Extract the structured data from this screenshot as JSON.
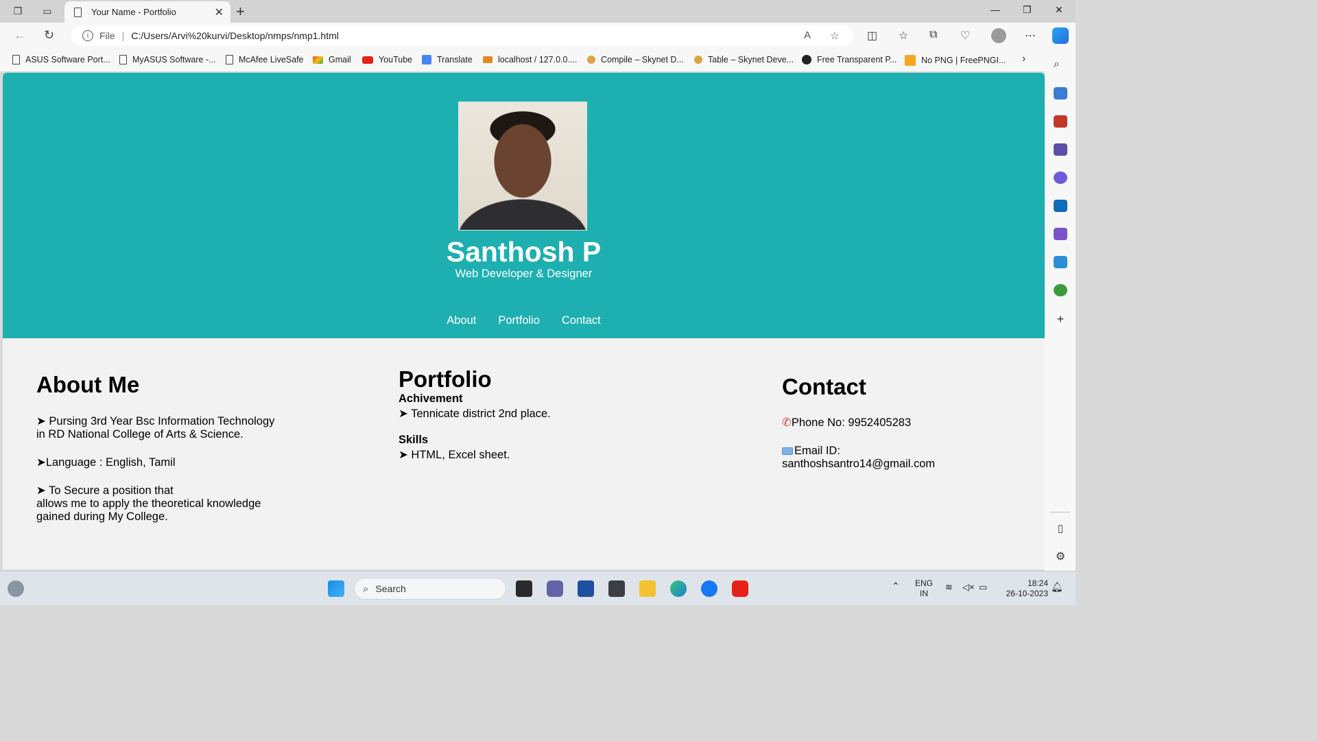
{
  "browser": {
    "tab_title": "Your Name - Portfolio",
    "file_label": "File",
    "address": "C:/Users/Arvi%20kurvi/Desktop/nmps/nmp1.html",
    "bookmarks": [
      {
        "label": "ASUS Software Port...",
        "icon": "document-icon"
      },
      {
        "label": "MyASUS Software -...",
        "icon": "document-icon"
      },
      {
        "label": "McAfee LiveSafe",
        "icon": "document-icon"
      },
      {
        "label": "Gmail",
        "icon": "gmail-icon"
      },
      {
        "label": "YouTube",
        "icon": "youtube-icon"
      },
      {
        "label": "Translate",
        "icon": "translate-icon"
      },
      {
        "label": "localhost / 127.0.0....",
        "icon": "phpmyadmin-icon"
      },
      {
        "label": "Compile – Skynet D...",
        "icon": "skynet-icon"
      },
      {
        "label": "Table – Skynet Deve...",
        "icon": "skynet-icon"
      },
      {
        "label": "Free Transparent P...",
        "icon": "png-icon"
      },
      {
        "label": "No PNG | FreePNGI...",
        "icon": "freepng-icon"
      }
    ]
  },
  "hero": {
    "name": "Santhosh P",
    "role": "Web Developer & Designer",
    "nav": [
      "About",
      "Portfolio",
      "Contact"
    ]
  },
  "about": {
    "title": "About Me",
    "line1a": "➤ Pursing 3rd Year Bsc Information Technology",
    "line1b": "in RD National College of Arts & Science.",
    "line2": "➤Language : English, Tamil",
    "line3a": "➤ To Secure a position that",
    "line3b": "allows me to apply the theoretical knowledge",
    "line3c": "gained during My College."
  },
  "portfolio": {
    "title": "Portfolio",
    "achievement_label": "Achivement",
    "achievement": "➤ Tennicate district 2nd place.",
    "skills_label": "Skills",
    "skills": "➤ HTML, Excel sheet."
  },
  "contact": {
    "title": "Contact",
    "phone": "Phone No: 9952405283",
    "email_label": "Email ID:",
    "email": "santhoshsantro14@gmail.com"
  },
  "taskbar": {
    "search_placeholder": "Search",
    "lang_top": "ENG",
    "lang_bottom": "IN",
    "time": "18:24",
    "date": "26-10-2023"
  },
  "colors": {
    "hero_bg": "#1eafb0",
    "page_bg": "#f2f2f2"
  }
}
